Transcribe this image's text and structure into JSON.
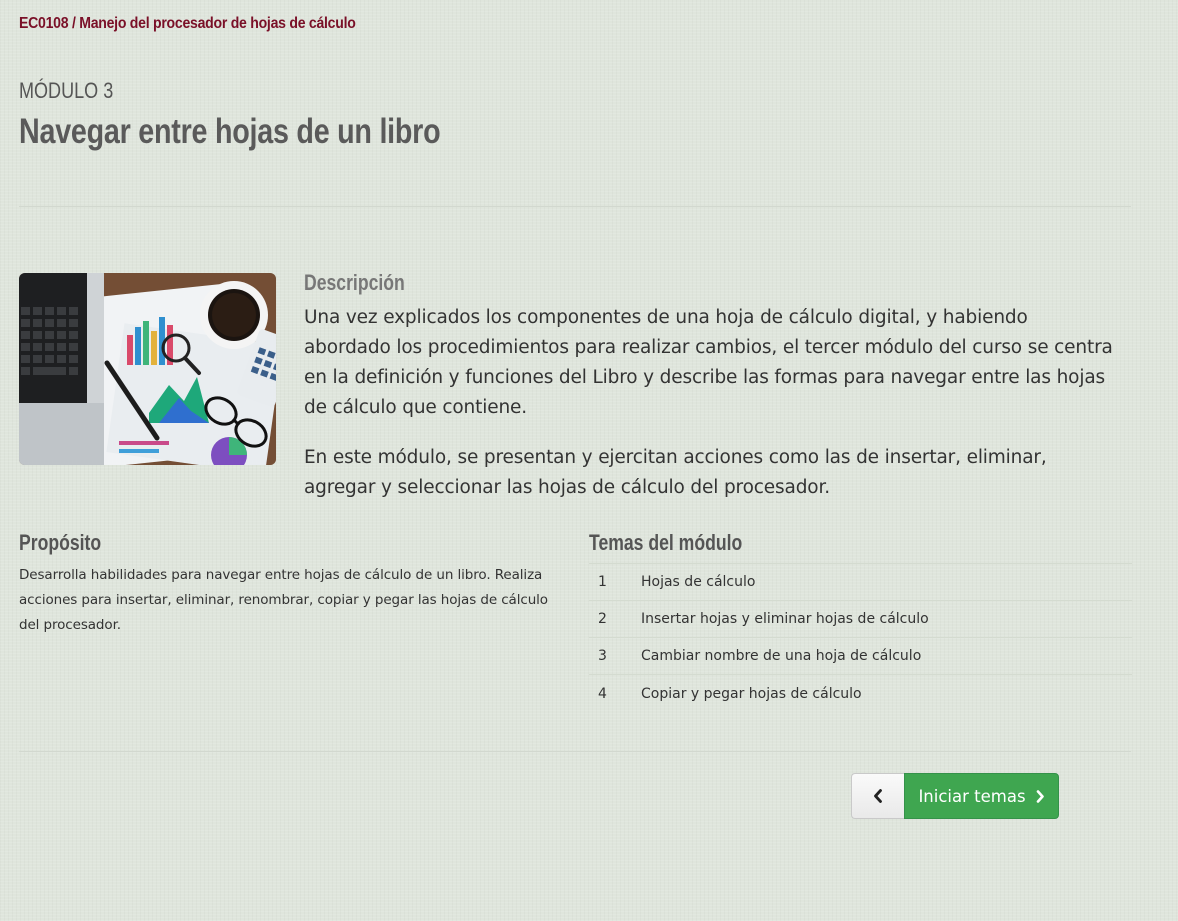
{
  "breadcrumb": "EC0108 / Manejo del procesador de hojas de cálculo",
  "module": {
    "number": "MÓDULO 3",
    "title": "Navegar entre hojas de un libro"
  },
  "description": {
    "heading": "Descripción",
    "paragraphs": [
      "Una vez explicados los componentes de una hoja de cálculo digital, y habiendo abordado los procedimientos para realizar cambios, el tercer módulo del curso se centra en la definición y funciones del Libro y describe las formas para navegar entre las hojas de cálculo que contiene.",
      "En este módulo, se presentan y ejercitan acciones como las de insertar, eliminar, agregar y seleccionar las hojas de cálculo del procesador."
    ]
  },
  "purpose": {
    "heading": "Propósito",
    "text": "Desarrolla habilidades para navegar entre hojas de cálculo de un libro. Realiza acciones para insertar, eliminar, renombrar, copiar y pegar las hojas de cálculo del procesador."
  },
  "topics": {
    "heading": "Temas del módulo",
    "items": [
      {
        "num": "1",
        "label": "Hojas de cálculo"
      },
      {
        "num": "2",
        "label": "Insertar hojas y eliminar hojas de cálculo"
      },
      {
        "num": "3",
        "label": "Cambiar nombre de una hoja de cálculo"
      },
      {
        "num": "4",
        "label": "Copiar y pegar hojas de cálculo"
      }
    ]
  },
  "nav": {
    "prev_icon": "chevron-left-icon",
    "next_label": "Iniciar temas",
    "next_icon": "chevron-right-icon"
  },
  "colors": {
    "breadcrumb": "#7a1028",
    "primary_button": "#3fa650",
    "background": "#dfe5dc"
  }
}
